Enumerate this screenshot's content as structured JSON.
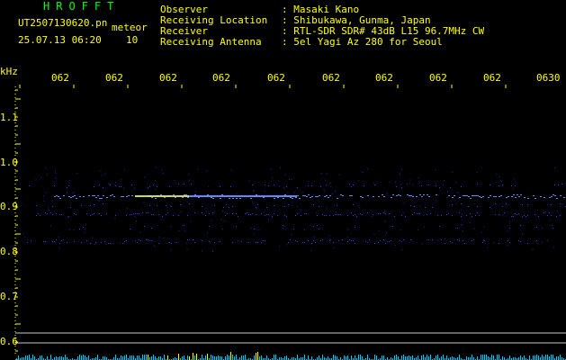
{
  "header": {
    "app_title": "HROFFT",
    "filename": "UT2507130620.pn",
    "filename_suffix": "meteor",
    "date_time": "25.07.13 06:20",
    "count": "10",
    "info": [
      {
        "label": "Observer",
        "value": ": Masaki Kano"
      },
      {
        "label": "Receiving Location",
        "value": ": Shibukawa, Gunma, Japan"
      },
      {
        "label": "Receiver",
        "value": ": RTL-SDR SDR# 43dB L15 96.7MHz CW"
      },
      {
        "label": "Receiving Antenna",
        "value": ": 5el Yagi Az 280 for Seoul"
      }
    ]
  },
  "y_axis": {
    "unit": "kHz",
    "ticks": [
      "1.1",
      "1.0",
      "0.9",
      "0.8",
      "0.7",
      "0.6"
    ]
  },
  "x_axis": {
    "ticks": [
      "062",
      "062",
      "062",
      "062",
      "062",
      "062",
      "062",
      "062",
      "062",
      "0630"
    ]
  },
  "colors": {
    "background": "#000000",
    "text": "#ffff00",
    "title": "#00ff00",
    "signal": "#2f3cff",
    "strong_signal": "#5d8bff",
    "carrier": "#f0ff60",
    "baseline": "#c8c8c8",
    "histogram": "#00c8ff",
    "histogram_peak": "#ffff00"
  }
}
